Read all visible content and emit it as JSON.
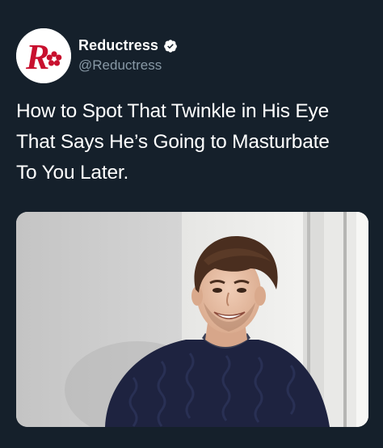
{
  "account": {
    "display_name": "Reductress",
    "handle": "@Reductress",
    "verified_icon": "verified-badge-icon",
    "avatar_icon": "reductress-logo"
  },
  "tweet": {
    "text_lines": [
      "How to Spot That Twinkle in His Eye",
      "That Says He’s Going to Masturbate",
      "To You Later."
    ],
    "media_description_icon": "photo-smiling-man"
  },
  "colors": {
    "background": "#15202b",
    "text_primary": "#ffffff",
    "text_secondary": "#8899a6",
    "brand_red": "#c8102e"
  }
}
